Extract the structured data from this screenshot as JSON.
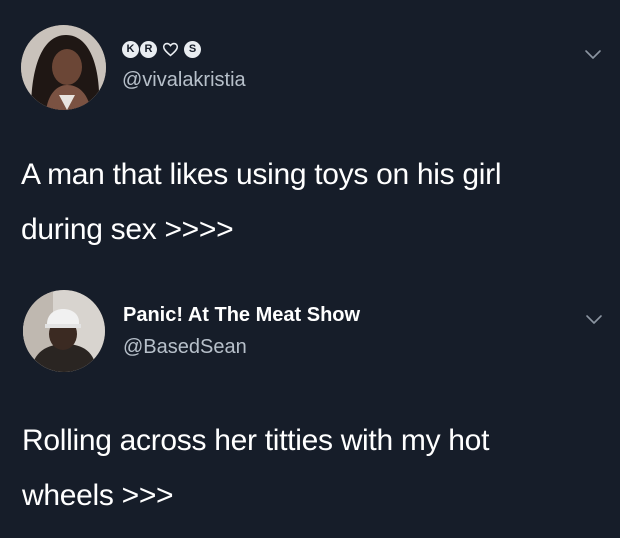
{
  "colors": {
    "background": "#161d29",
    "text_primary": "#ffffff",
    "text_secondary": "#b7c0ca"
  },
  "tweets": [
    {
      "display_badges": [
        {
          "text": "K",
          "icon": "badge-k"
        },
        {
          "text": "R",
          "icon": "badge-r"
        },
        {
          "text": "",
          "icon": "heart-outline-icon"
        },
        {
          "text": "S",
          "icon": "badge-s"
        }
      ],
      "handle": "@vivalakristia",
      "text_lines": [
        "A man that likes using toys on his girl",
        "during sex >>>>"
      ],
      "menu_icon": "chevron-down-icon"
    },
    {
      "display_name": "Panic! At The Meat Show",
      "handle": "@BasedSean",
      "text_lines": [
        "Rolling across her titties with my hot",
        "wheels >>>"
      ],
      "menu_icon": "chevron-down-icon"
    }
  ]
}
